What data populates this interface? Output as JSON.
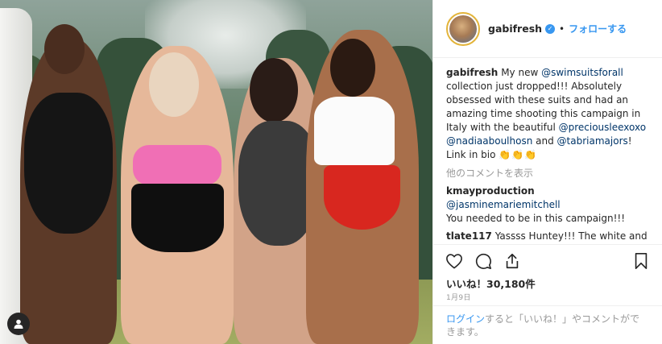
{
  "post": {
    "username": "gabifresh",
    "follow_label": "フォローする",
    "separator": "•"
  },
  "caption": {
    "author": "gabifresh",
    "parts": [
      "My new ",
      "@swimsuitsforall",
      " collection just dropped!!! Absolutely obsessed with these suits and had an amazing time shooting this campaign in Italy with the beautiful ",
      "@preciousleexoxo",
      " ",
      "@nadiaaboulhosn",
      " and ",
      "@tabriamajors",
      "! Link in bio ",
      "👏👏👏"
    ]
  },
  "show_more_comments": "他のコメントを表示",
  "comments": [
    {
      "author": "kmayproduction",
      "mention": "@jasminemariemitchell",
      "text": "You needed to be in this campaign!!!"
    },
    {
      "author": "tlate117",
      "text": "Yassss Huntey!!! The white and red swimsuit is litttttt!!!!"
    }
  ],
  "likes": "いいね！30,180件",
  "date": "1月9日",
  "login": {
    "link": "ログイン",
    "text": "すると「いいね！」やコメントができます。"
  },
  "icons": {
    "like": "heart-icon",
    "comment": "comment-icon",
    "share": "share-icon",
    "save": "bookmark-icon",
    "verified": "verified-badge-icon",
    "tag": "user-tag-icon"
  },
  "colors": {
    "accent": "#3897f0",
    "text": "#262626",
    "muted": "#999999",
    "mention": "#003569"
  }
}
